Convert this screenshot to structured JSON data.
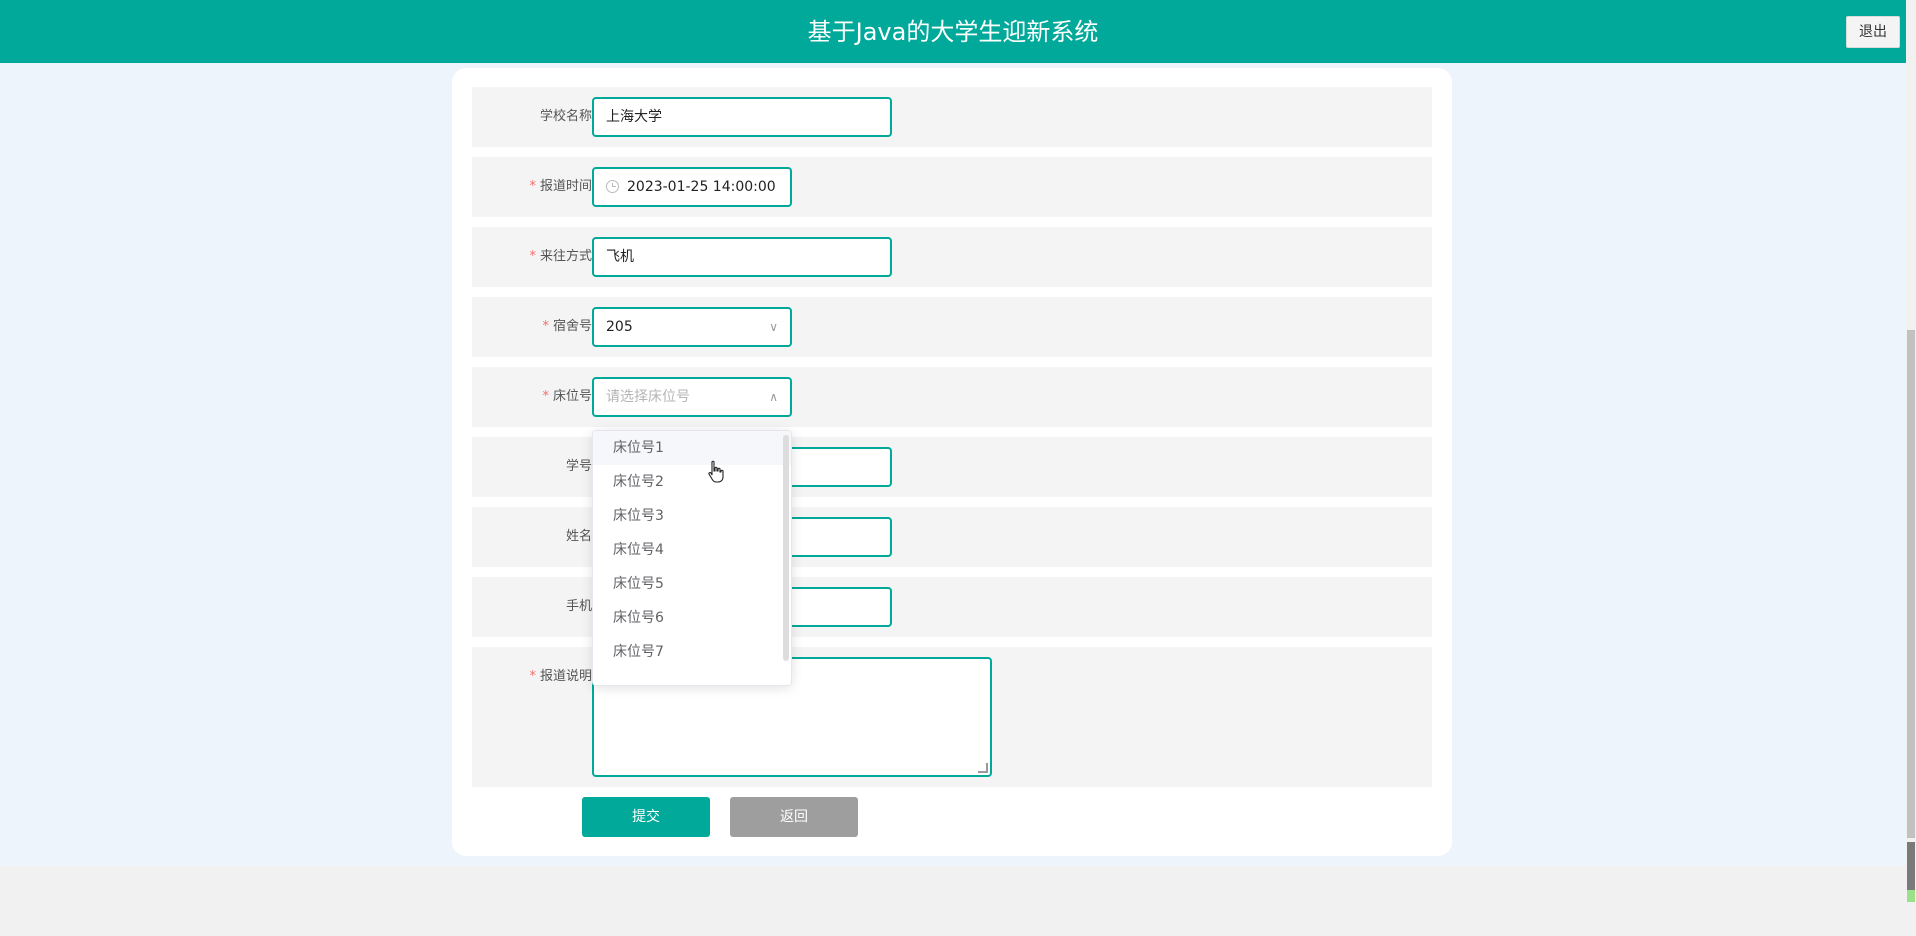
{
  "header": {
    "title": "基于Java的大学生迎新系统",
    "logout_label": "退出"
  },
  "form": {
    "school_name": {
      "label": "学校名称",
      "value": "上海大学",
      "required": false
    },
    "report_time": {
      "label": "报道时间",
      "value": "2023-01-25 14:00:00",
      "required": true
    },
    "travel_mode": {
      "label": "来往方式",
      "value": "飞机",
      "required": true
    },
    "dorm_number": {
      "label": "宿舍号",
      "value": "205",
      "required": true
    },
    "bed_number": {
      "label": "床位号",
      "placeholder": "请选择床位号",
      "required": true
    },
    "student_id": {
      "label": "学号",
      "required": false
    },
    "name": {
      "label": "姓名",
      "required": false
    },
    "phone": {
      "label": "手机",
      "required": false
    },
    "report_note": {
      "label": "报道说明",
      "required": true
    },
    "required_mark": "*"
  },
  "bed_dropdown": {
    "options": [
      "床位号1",
      "床位号2",
      "床位号3",
      "床位号4",
      "床位号5",
      "床位号6",
      "床位号7"
    ],
    "hovered_index": 0
  },
  "buttons": {
    "submit_label": "提交",
    "back_label": "返回"
  },
  "colors": {
    "accent": "#00a99a",
    "required": "#f56c6c",
    "back_button": "#9e9e9e"
  }
}
